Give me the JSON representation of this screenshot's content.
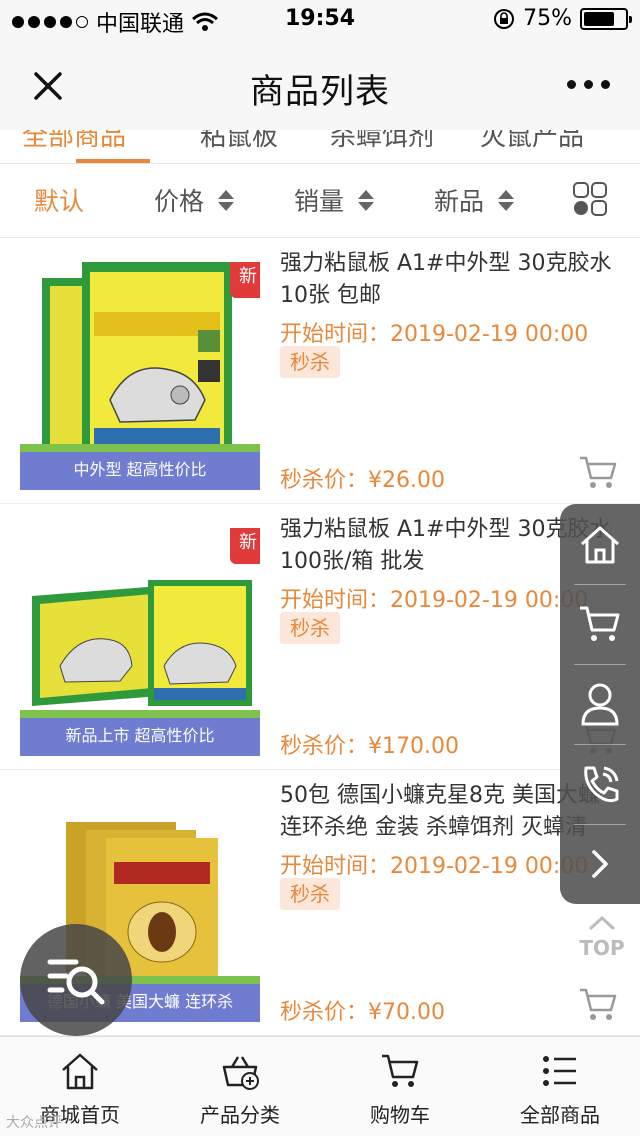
{
  "status_bar": {
    "carrier": "中国联通",
    "time": "19:54",
    "battery": "75%",
    "battery_level": 0.75
  },
  "nav": {
    "title": "商品列表"
  },
  "category_tabs_partial": [
    "全部商品",
    "粘鼠板",
    "杀蟑饵剂",
    "灭鼠产品"
  ],
  "sort_bar": {
    "default_label": "默认",
    "price_label": "价格",
    "sales_label": "销量",
    "new_label": "新品"
  },
  "products": [
    {
      "name": "强力粘鼠板 A1#中外型 30克胶水 10张 包邮",
      "start_time": "开始时间：2019-02-19 00:00",
      "tag": "秒杀",
      "price": "秒杀价：¥26.00",
      "badge": "新",
      "caption": "中外型 超高性价比"
    },
    {
      "name": "强力粘鼠板 A1#中外型 30克胶水 100张/箱 批发",
      "start_time": "开始时间：2019-02-19 00:00",
      "tag": "秒杀",
      "price": "秒杀价：¥170.00",
      "badge": "新",
      "caption": "新品上市 超高性价比"
    },
    {
      "name": "50包 德国小蠊克星8克 美国大蠊连环杀绝 金装 杀蟑饵剂 灭蟑清",
      "start_time": "开始时间：2019-02-19 00:00",
      "tag": "秒杀",
      "price": "秒杀价：¥70.00",
      "badge": "",
      "caption": "德国小蠊 美国大蠊 连环杀"
    }
  ],
  "top_button": "TOP",
  "tabbar": {
    "home": "商城首页",
    "category": "产品分类",
    "cart": "购物车",
    "all": "全部商品"
  },
  "colors": {
    "accent": "#e8883a",
    "new_badge": "#e03a3a",
    "caption_bg": "#6f7ccf"
  },
  "watermark": "大众点评"
}
